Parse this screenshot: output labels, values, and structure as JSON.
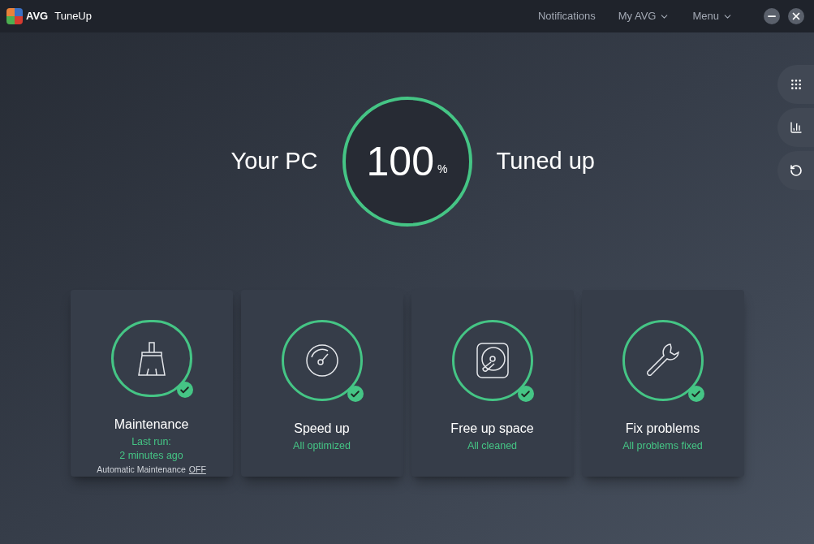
{
  "app": {
    "logo_text": "AVG",
    "title": "TuneUp"
  },
  "nav": [
    {
      "label": "Notifications",
      "dropdown": false
    },
    {
      "label": "My AVG",
      "dropdown": true
    },
    {
      "label": "Menu",
      "dropdown": true
    }
  ],
  "hero": {
    "left": "Your PC",
    "value": "100",
    "unit": "%",
    "right": "Tuned up"
  },
  "cards": [
    {
      "title": "Maintenance",
      "status": [
        "Last run:",
        "2 minutes ago"
      ],
      "done": true,
      "footer": {
        "label": "Automatic Maintenance",
        "link": "OFF"
      }
    },
    {
      "title": "Speed up",
      "status": [
        "All optimized"
      ],
      "done": true
    },
    {
      "title": "Free up space",
      "status": [
        "All cleaned"
      ],
      "done": true
    },
    {
      "title": "Fix problems",
      "status": [
        "All problems fixed"
      ],
      "done": true
    }
  ]
}
